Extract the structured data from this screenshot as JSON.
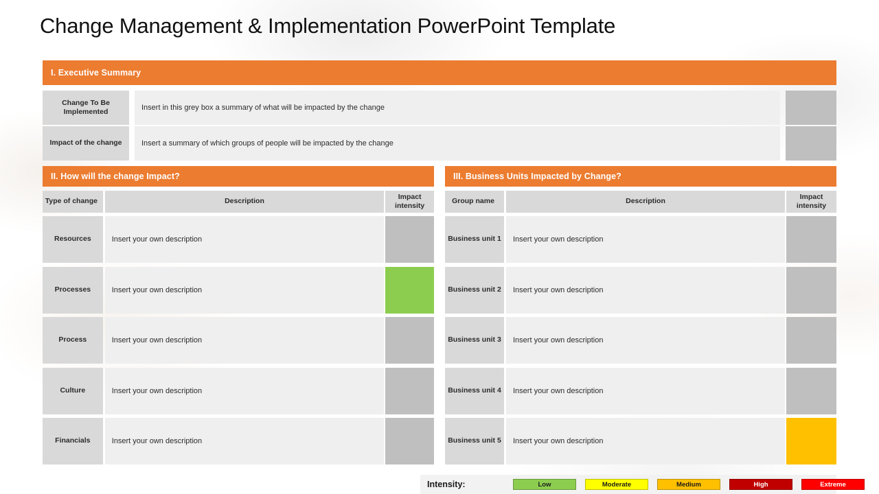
{
  "title": "Change Management & Implementation PowerPoint Template",
  "colors": {
    "banner_orange": "#ec7c30",
    "label_grey": "#d9d9d9",
    "desc_grey": "#efefef",
    "swatch_grey": "#bfbfbf",
    "low_green": "#8ccd4f",
    "moderate_yellow": "#ffff00",
    "medium_amber": "#ffc000",
    "high_darkred": "#c00000",
    "extreme_red": "#ff0000"
  },
  "exec_summary": {
    "banner": "I. Executive Summary",
    "rows": [
      {
        "label": "Change To Be Implemented",
        "description": "Insert in this grey box a summary of what will be impacted by the change",
        "intensity_color": "#bfbfbf"
      },
      {
        "label": "Impact of the change",
        "description": "Insert a summary of which groups of people will be impacted by the change",
        "intensity_color": "#bfbfbf"
      }
    ]
  },
  "impact_table": {
    "banner": "II. How will the change Impact?",
    "headers": {
      "label": "Type of change",
      "description": "Description",
      "intensity": "Impact intensity"
    },
    "rows": [
      {
        "label": "Resources",
        "description": "Insert your own description",
        "intensity_color": "#bfbfbf"
      },
      {
        "label": "Processes",
        "description": "Insert your own description",
        "intensity_color": "#8ccd4f"
      },
      {
        "label": "Process",
        "description": "Insert your own description",
        "intensity_color": "#bfbfbf"
      },
      {
        "label": "Culture",
        "description": "Insert your own description",
        "intensity_color": "#bfbfbf"
      },
      {
        "label": "Financials",
        "description": "Insert your own description",
        "intensity_color": "#bfbfbf"
      }
    ]
  },
  "business_units_table": {
    "banner": "III. Business Units Impacted by Change?",
    "headers": {
      "label": "Group name",
      "description": "Description",
      "intensity": "Impact intensity"
    },
    "rows": [
      {
        "label": "Business unit 1",
        "description": "Insert your own description",
        "intensity_color": "#bfbfbf"
      },
      {
        "label": "Business unit 2",
        "description": "Insert your own description",
        "intensity_color": "#bfbfbf"
      },
      {
        "label": "Business unit 3",
        "description": "Insert your own description",
        "intensity_color": "#bfbfbf"
      },
      {
        "label": "Business unit 4",
        "description": "Insert your own description",
        "intensity_color": "#bfbfbf"
      },
      {
        "label": "Business unit 5",
        "description": "Insert your own description",
        "intensity_color": "#ffc000"
      }
    ]
  },
  "legend": {
    "label": "Intensity:",
    "items": [
      {
        "label": "Low",
        "color": "#8ccd4f",
        "text_color": "#1a1a1a"
      },
      {
        "label": "Moderate",
        "color": "#ffff00",
        "text_color": "#1a1a1a"
      },
      {
        "label": "Medium",
        "color": "#ffc000",
        "text_color": "#1a1a1a"
      },
      {
        "label": "High",
        "color": "#c00000",
        "text_color": "#ffffff"
      },
      {
        "label": "Extreme",
        "color": "#ff0000",
        "text_color": "#ffffff"
      }
    ]
  }
}
